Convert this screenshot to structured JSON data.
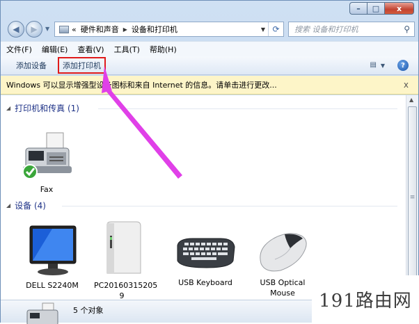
{
  "window": {
    "caption": {
      "minimize": "–",
      "maximize": "□",
      "close": "x"
    }
  },
  "nav": {
    "back": "◀",
    "forward": "▶",
    "address": {
      "prefix": "«",
      "crumbs": [
        "硬件和声音",
        "设备和打印机"
      ],
      "sep": "▶"
    },
    "search_placeholder": "搜索 设备和打印机"
  },
  "menu": {
    "items": [
      "文件(F)",
      "编辑(E)",
      "查看(V)",
      "工具(T)",
      "帮助(H)"
    ]
  },
  "toolbar": {
    "add_device": "添加设备",
    "add_printer": "添加打印机",
    "help": "?"
  },
  "infobar": {
    "text": "Windows 可以显示增强型设备图标和来自 Internet 的信息。请单击进行更改...",
    "close": "x"
  },
  "groups": {
    "printers": {
      "label": "打印机和传真 (1)"
    },
    "devices": {
      "label": "设备 (4)"
    }
  },
  "printers": [
    {
      "name": "Fax"
    }
  ],
  "devices": [
    {
      "name": "DELL S2240M"
    },
    {
      "name": "PC20160315205",
      "name2": "9"
    },
    {
      "name": "USB Keyboard"
    },
    {
      "name": "USB Optical",
      "name2": "Mouse"
    }
  ],
  "status": {
    "count": "5 个对象"
  },
  "watermark": "191路由网",
  "colors": {
    "highlight": "#e01a1a",
    "arrow": "#e040e8",
    "link": "#1e3287"
  }
}
